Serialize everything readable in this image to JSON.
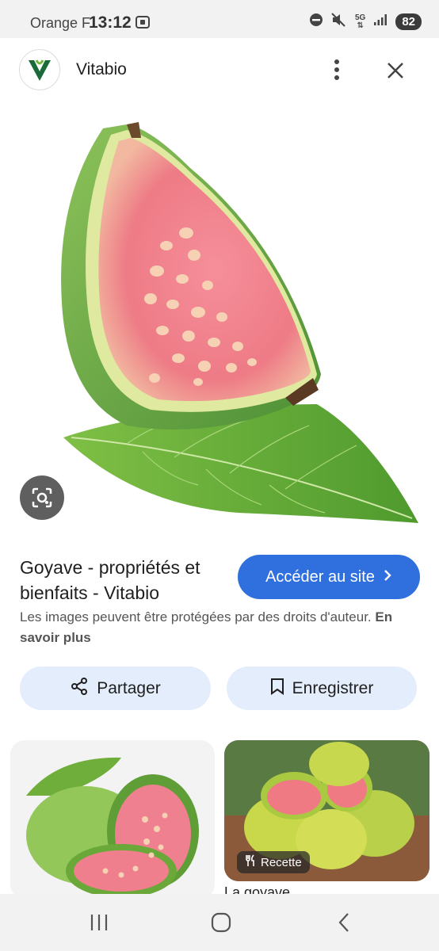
{
  "status_bar": {
    "carrier": "Orange F",
    "time": "13:12",
    "network": "5G",
    "battery": "82"
  },
  "header": {
    "site_name": "Vitabio",
    "logo_letter": "V",
    "icons": [
      "vitabio-logo",
      "more-vert-icon",
      "close-icon"
    ]
  },
  "result": {
    "title": "Goyave - propriétés et bienfaits - Vitabio",
    "visit_label": "Accéder au site",
    "copyright_text": "Les images peuvent être protégées par des droits d'auteur.",
    "learn_more": "En savoir plus"
  },
  "actions": {
    "share_label": "Partager",
    "save_label": "Enregistrer"
  },
  "related": {
    "chip_label": "Recette",
    "caption": "La goyave"
  },
  "colors": {
    "accent": "#2f6fde",
    "chip_bg": "#e4edfb",
    "status_bg": "#f2f2f2"
  }
}
